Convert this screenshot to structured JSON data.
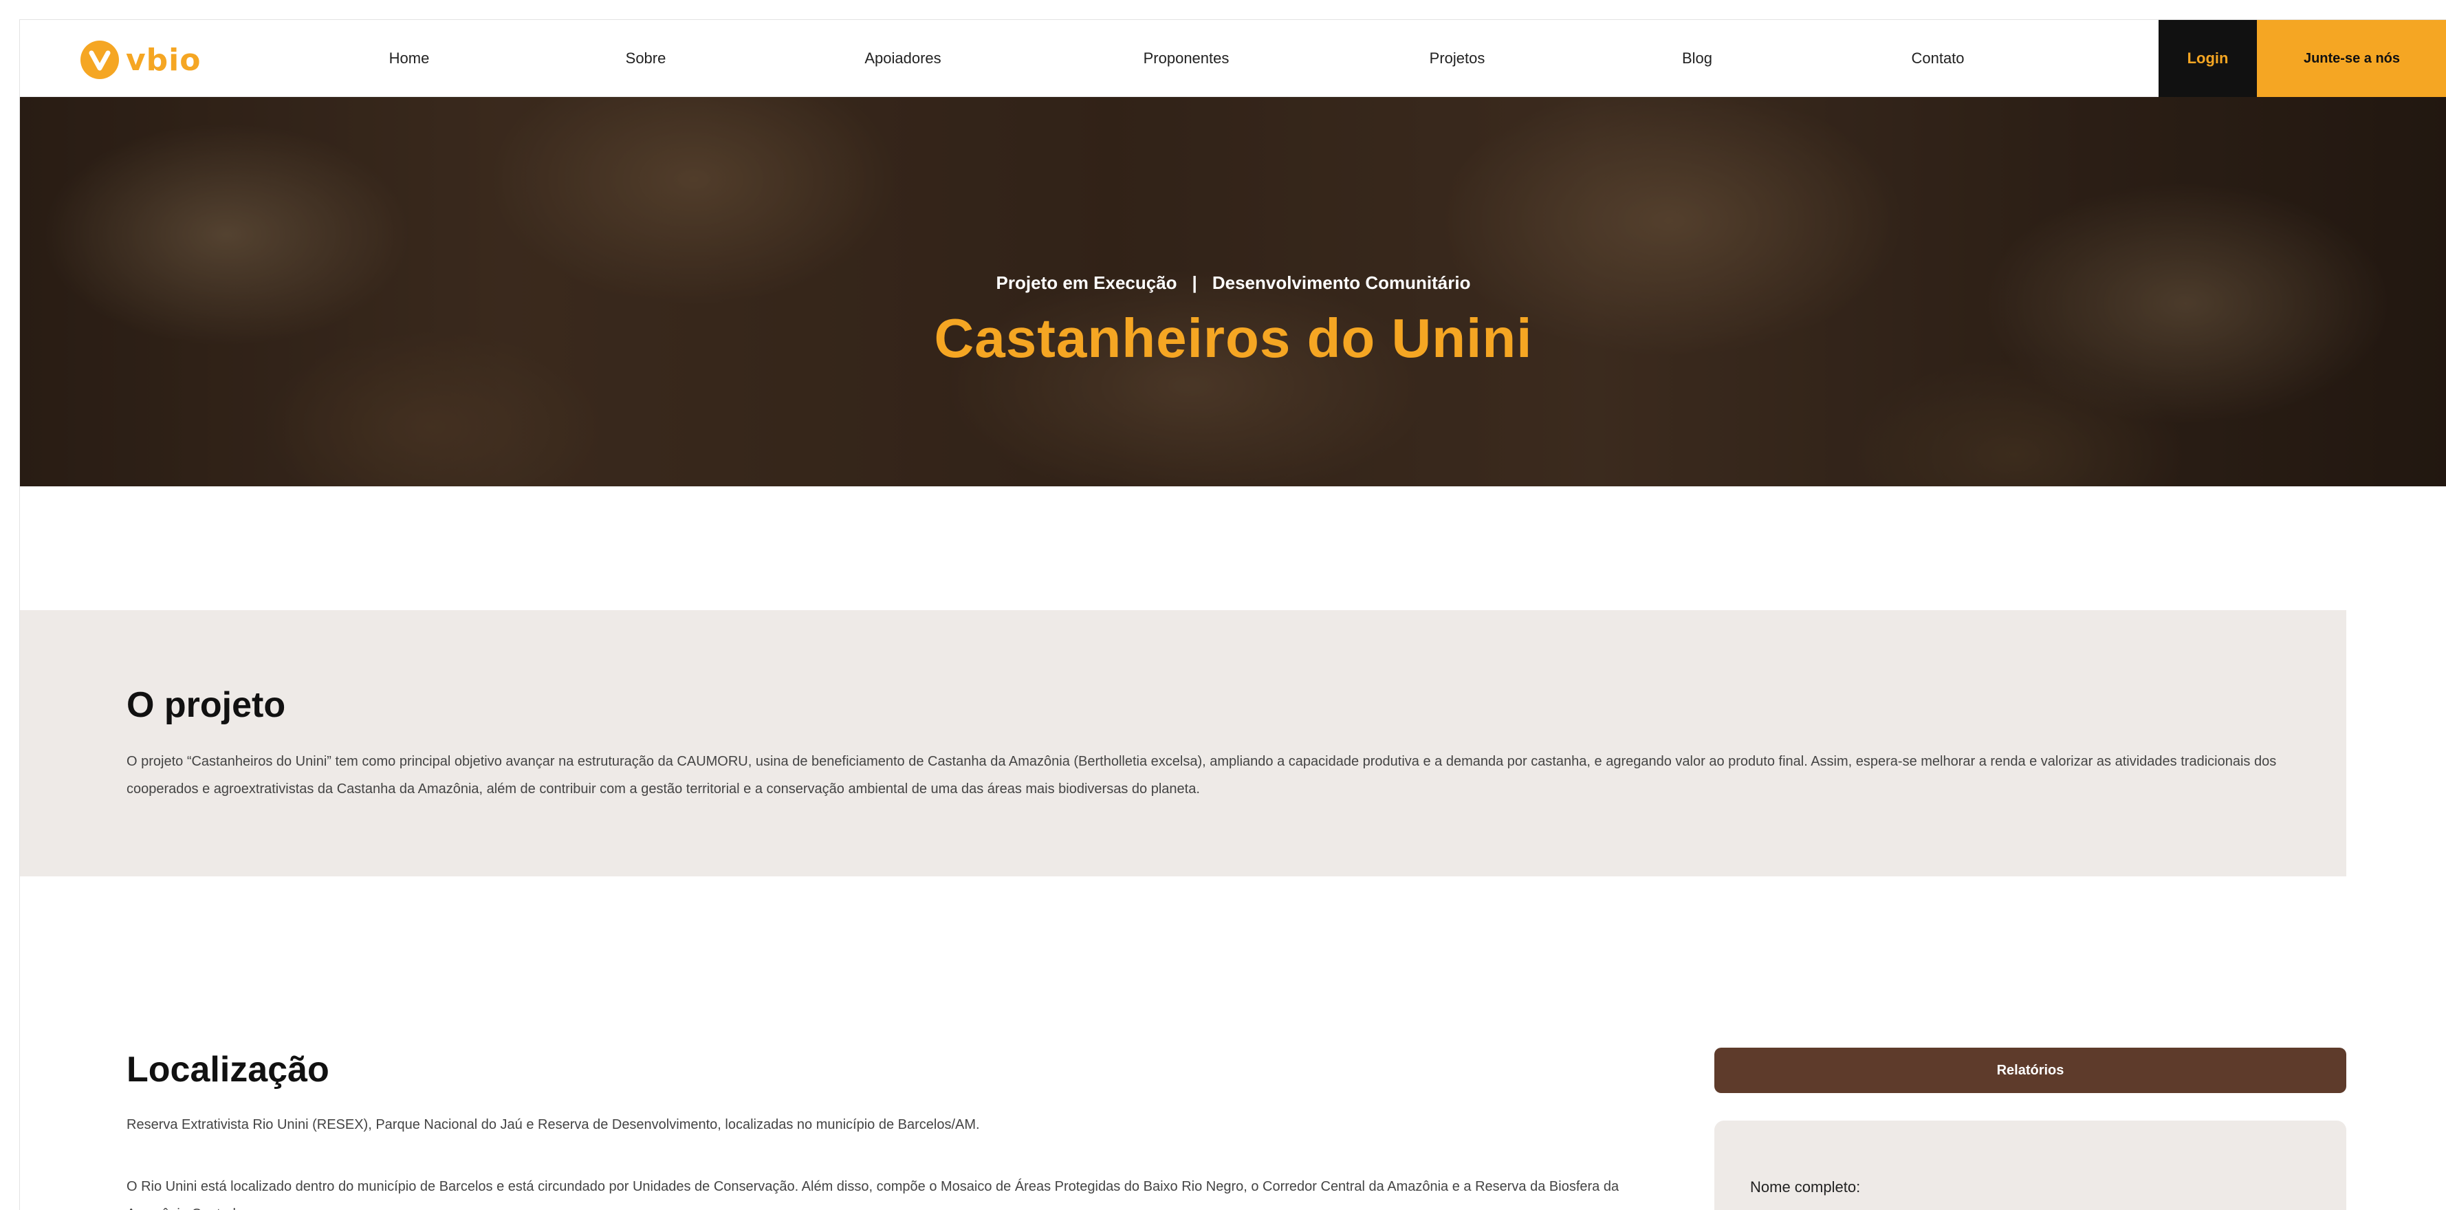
{
  "header": {
    "logo_text": "vbio",
    "nav": [
      "Home",
      "Sobre",
      "Apoiadores",
      "Proponentes",
      "Projetos",
      "Blog",
      "Contato"
    ],
    "login_label": "Login",
    "join_label": "Junte-se a nós",
    "brand_color": "#f5a623"
  },
  "hero": {
    "status": "Projeto em Execução",
    "separator": "|",
    "category": "Desenvolvimento Comunitário",
    "title": "Castanheiros do Unini"
  },
  "project": {
    "heading": "O projeto",
    "text": "O projeto “Castanheiros do Unini” tem como principal objetivo avançar na estruturação da CAUMORU, usina de beneficiamento de Castanha da Amazônia (Bertholletia excelsa), ampliando a capacidade produtiva e a demanda por castanha, e agregando valor ao produto final. Assim, espera-se melhorar a renda e valorizar as atividades tradicionais dos cooperados e agroextrativistas da Castanha da Amazônia, além de contribuir com a gestão territorial e a conservação ambiental de uma das áreas mais biodiversas do planeta."
  },
  "location": {
    "heading": "Localização",
    "paragraph1": "Reserva Extrativista Rio Unini (RESEX), Parque Nacional do Jaú e Reserva de Desenvolvimento, localizadas no município de Barcelos/AM.",
    "paragraph2": "O Rio Unini está localizado dentro do município de Barcelos e está circundado por Unidades de Conservação. Além disso, compõe o Mosaico de Áreas Protegidas do Baixo Rio Negro, o Corredor Central da Amazônia e a Reserva da Biosfera da Amazônia Central."
  },
  "sidebar": {
    "reports_label": "Relatórios",
    "form_name_label": "Nome completo:"
  }
}
